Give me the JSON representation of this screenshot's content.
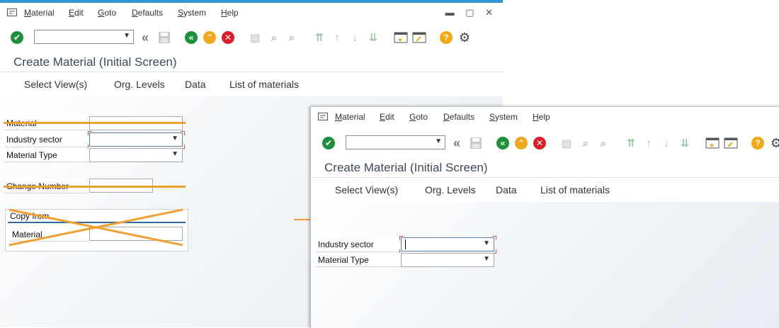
{
  "menu": {
    "items": [
      {
        "label": "Material"
      },
      {
        "label": "Edit"
      },
      {
        "label": "Goto"
      },
      {
        "label": "Defaults"
      },
      {
        "label": "System"
      },
      {
        "label": "Help"
      }
    ],
    "window_controls": "▬ ▢ ✕"
  },
  "toolbar": {
    "command_field_value": "",
    "icons": [
      "enter-check-icon",
      "command-field",
      "collapse-icon",
      "save-icon",
      "back-icon",
      "exit-icon",
      "cancel-icon",
      "print-icon",
      "find-icon",
      "find-next-icon",
      "first-page-icon",
      "previous-page-icon",
      "next-page-icon",
      "last-page-icon",
      "new-session-icon",
      "shortcut-icon",
      "help-icon",
      "settings-icon"
    ]
  },
  "title": "Create Material (Initial Screen)",
  "appbar": {
    "select_views": "Select View(s)",
    "org_levels": "Org. Levels",
    "data": "Data",
    "list_of_materials": "List of materials"
  },
  "before": {
    "fields": {
      "material_label": "Material",
      "material_value": "",
      "industry_sector_label": "Industry sector",
      "industry_sector_value": "",
      "material_type_label": "Material Type",
      "material_type_value": "",
      "change_number_label": "Change Number",
      "change_number_value": ""
    },
    "copy_from": {
      "title": "Copy from...",
      "material_label": "Material",
      "material_value": ""
    }
  },
  "after": {
    "fields": {
      "industry_sector_label": "Industry sector",
      "industry_sector_value": "",
      "material_type_label": "Material Type",
      "material_type_value": ""
    }
  },
  "colors": {
    "accent_blue": "#2e95d3",
    "strike_orange": "#f0a030",
    "ok_green": "#1e8f3a",
    "exit_yellow": "#f0a81e",
    "cancel_red": "#d9202a",
    "help_yellow": "#f3a712"
  }
}
